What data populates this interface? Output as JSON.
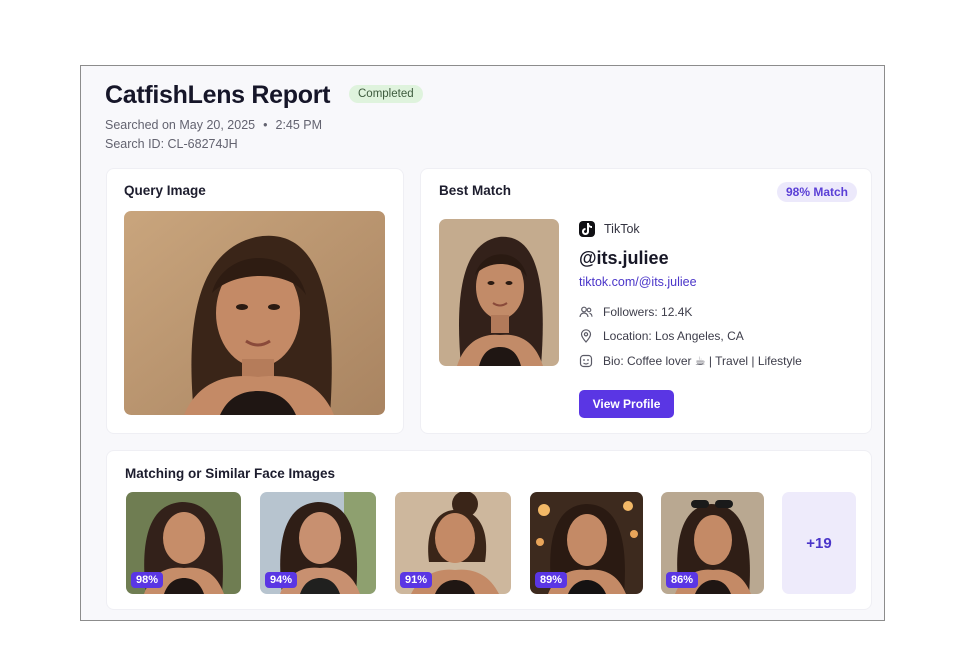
{
  "header": {
    "title": "CatfishLens Report",
    "status": "Completed",
    "searched_on": "Searched on May 20, 2025",
    "time": "2:45 PM",
    "search_id": "Search ID: CL-68274JH"
  },
  "query": {
    "title": "Query Image"
  },
  "best_match": {
    "title": "Best Match",
    "match_badge": "98% Match",
    "platform": "TikTok",
    "handle": "@its.juliee",
    "link": "tiktok.com/@its.juliee",
    "followers": "Followers: 12.4K",
    "location": "Location: Los Angeles, CA",
    "bio": "Bio: Coffee lover ☕ | Travel | Lifestyle",
    "button_label": "View Profile"
  },
  "similar": {
    "title": "Matching or Similar Face Images",
    "items": [
      {
        "percent": "98%"
      },
      {
        "percent": "94%"
      },
      {
        "percent": "91%"
      },
      {
        "percent": "89%"
      },
      {
        "percent": "86%"
      }
    ],
    "more_label": "+19"
  },
  "colors": {
    "accent": "#5a36e4",
    "link": "#4a35c9",
    "completed_bg": "#dff3dd",
    "match_bg": "#ece9fb"
  }
}
